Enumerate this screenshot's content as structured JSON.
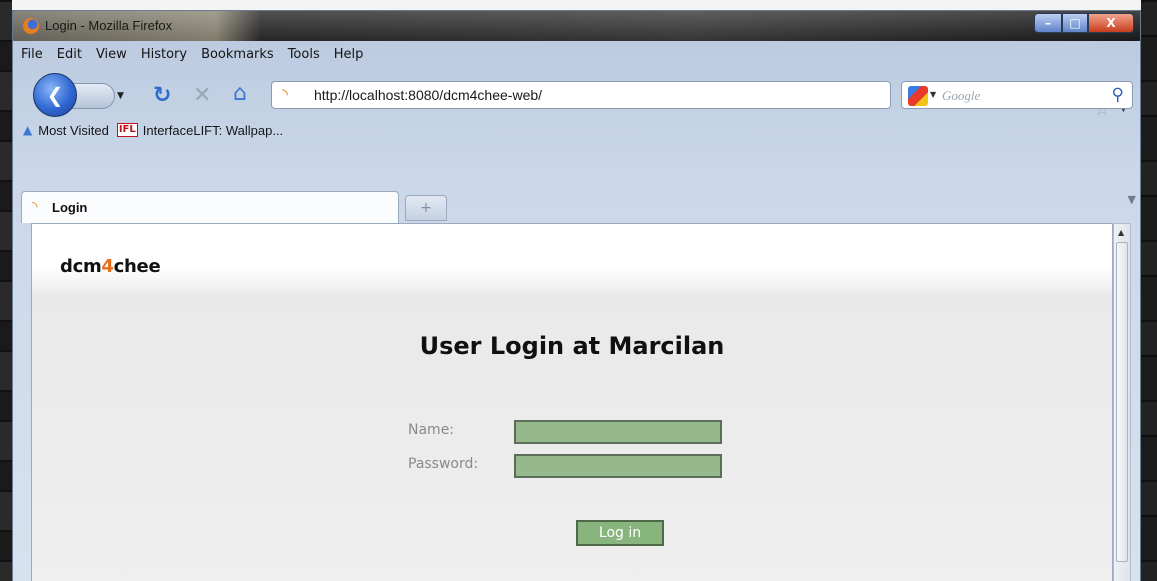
{
  "window": {
    "title": "Login - Mozilla Firefox",
    "min_glyph": "–",
    "max_glyph": "□",
    "close_glyph": "X"
  },
  "menu": [
    "File",
    "Edit",
    "View",
    "History",
    "Bookmarks",
    "Tools",
    "Help"
  ],
  "navbar": {
    "url": "http://localhost:8080/dcm4chee-web/",
    "search_placeholder": "Google"
  },
  "bookmarks": {
    "most_visited": "Most Visited",
    "ifl_badge": "IFL",
    "interfacelift": "InterfaceLIFT: Wallpap..."
  },
  "tabs": {
    "active_label": "Login",
    "new_tab_glyph": "+"
  },
  "page": {
    "brand_prefix": "dcm",
    "brand_4": "4",
    "brand_suffix": "chee",
    "login_title": "User Login at Marcilan",
    "name_label": "Name:",
    "password_label": "Password:",
    "login_button": "Log in"
  },
  "icons": {
    "back": "back-arrow-icon",
    "reload": "reload-icon",
    "stop": "stop-icon",
    "home": "home-icon",
    "bookmark_star": "star-icon",
    "search": "search-icon"
  },
  "colors": {
    "field_fill": "#96b88d",
    "button_fill": "#88b47e",
    "brand_accent": "#e4701e"
  }
}
